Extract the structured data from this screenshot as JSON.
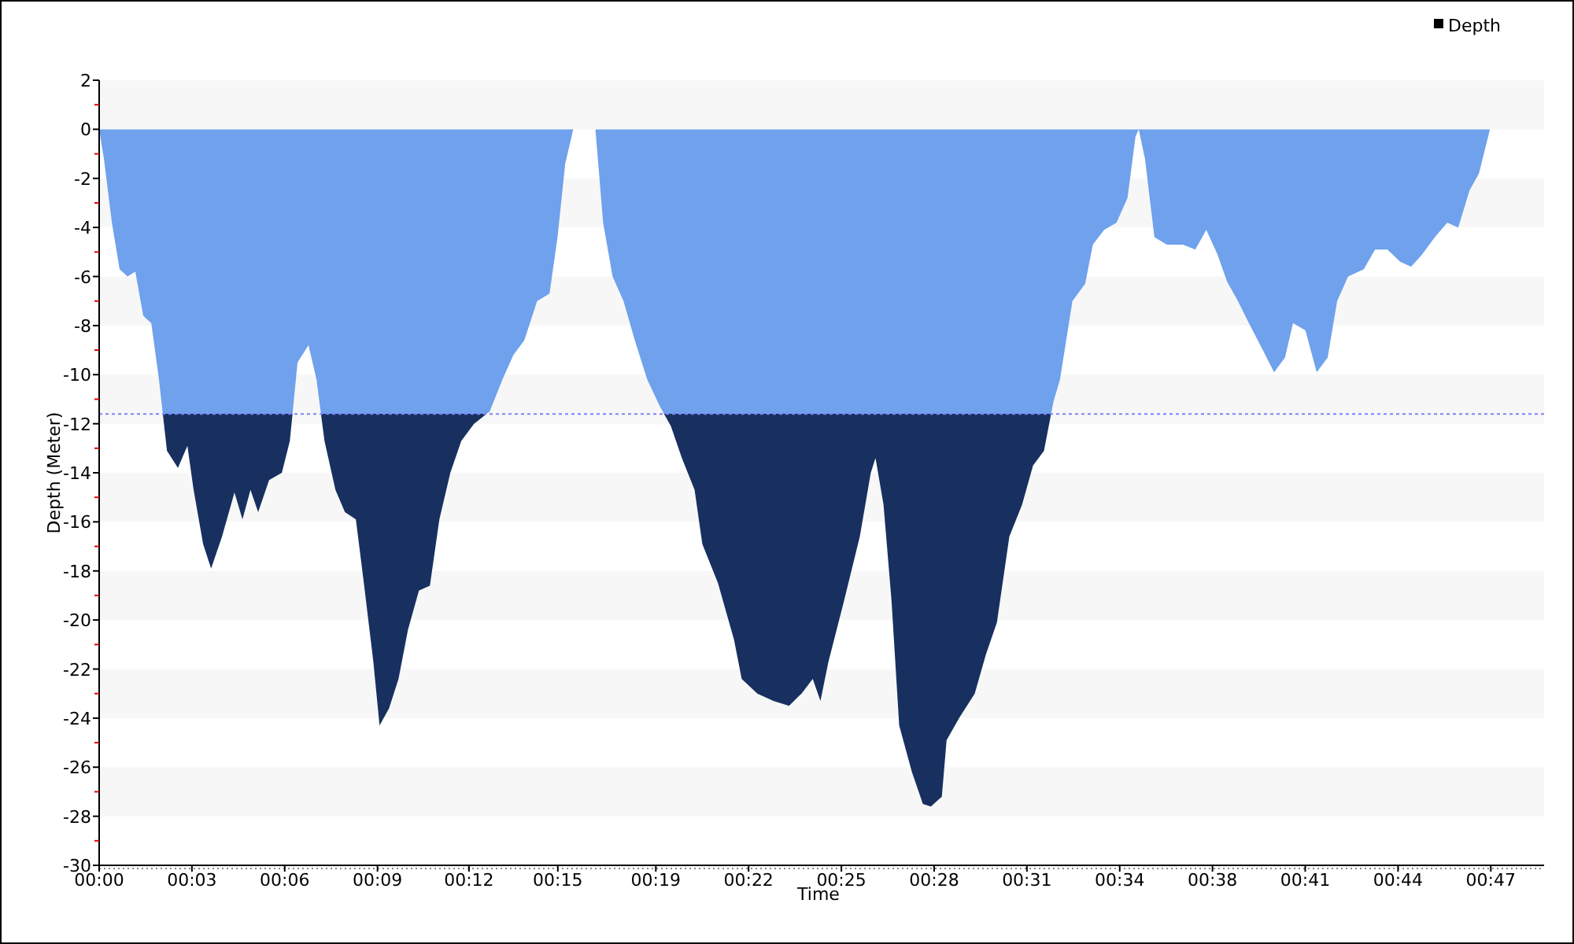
{
  "chart": {
    "chart_data": {
      "type": "area",
      "xlabel": "Time",
      "ylabel": "Depth (Meter)",
      "x": [
        0,
        0.16,
        0.43,
        0.69,
        0.96,
        1.22,
        1.49,
        1.76,
        2.02,
        2.29,
        2.66,
        2.98,
        3.19,
        3.51,
        3.78,
        4.15,
        4.57,
        4.84,
        5.11,
        5.37,
        5.74,
        6.17,
        6.44,
        6.7,
        7.07,
        7.34,
        7.61,
        7.98,
        8.3,
        8.67,
        8.94,
        9.26,
        9.47,
        9.79,
        10.11,
        10.43,
        10.8,
        11.17,
        11.49,
        11.86,
        12.23,
        12.66,
        13.19,
        13.62,
        13.99,
        14.36,
        14.79,
        15.21,
        15.48,
        15.74,
        16.01,
        16.76,
        17.02,
        17.34,
        17.71,
        18.09,
        18.51,
        18.94,
        19.31,
        19.68,
        20.11,
        20.37,
        20.9,
        21.44,
        21.7,
        22.23,
        22.77,
        23.3,
        23.72,
        24.1,
        24.36,
        24.63,
        25.16,
        25.69,
        26.06,
        26.22,
        26.49,
        26.76,
        27.02,
        27.45,
        27.82,
        28.09,
        28.46,
        28.62,
        29.04,
        29.57,
        29.95,
        30.32,
        30.74,
        31.17,
        31.54,
        31.91,
        32.23,
        32.45,
        32.87,
        33.3,
        33.56,
        33.94,
        34.36,
        34.73,
        35.0,
        35.11,
        35.32,
        35.64,
        36.06,
        36.6,
        37.02,
        37.39,
        37.77,
        38.09,
        38.46,
        38.83,
        39.26,
        39.68,
        40.05,
        40.32,
        40.74,
        41.12,
        41.49,
        41.81,
        42.18,
        42.71,
        43.09,
        43.51,
        43.94,
        44.31,
        44.68,
        45.11,
        45.53,
        45.9,
        46.28,
        46.6,
        46.97
      ],
      "series": [
        {
          "name": "Depth",
          "color": "#6fa1ec",
          "values": [
            0,
            -1.2,
            -3.8,
            -5.7,
            -6.0,
            -5.8,
            -7.6,
            -7.9,
            -10.2,
            -13.1,
            -13.8,
            -12.9,
            -14.7,
            -16.9,
            -17.9,
            -16.6,
            -14.8,
            -15.9,
            -14.7,
            -15.6,
            -14.3,
            -14.0,
            -12.7,
            -9.5,
            -8.8,
            -10.2,
            -12.7,
            -14.7,
            -15.6,
            -15.9,
            -18.5,
            -21.7,
            -24.3,
            -23.6,
            -22.4,
            -20.4,
            -18.8,
            -18.6,
            -15.9,
            -14.0,
            -12.7,
            -12.0,
            -11.5,
            -10.2,
            -9.2,
            -8.6,
            -7.0,
            -6.7,
            -4.4,
            -1.4,
            0,
            0,
            -3.8,
            -6.0,
            -7.0,
            -8.6,
            -10.2,
            -11.3,
            -12.1,
            -13.4,
            -14.7,
            -16.9,
            -18.5,
            -20.8,
            -22.4,
            -23.0,
            -23.3,
            -23.5,
            -23.0,
            -22.4,
            -23.3,
            -21.7,
            -19.2,
            -16.6,
            -14.0,
            -13.4,
            -15.3,
            -19.2,
            -24.3,
            -26.2,
            -27.5,
            -27.6,
            -27.2,
            -24.9,
            -24.0,
            -23.0,
            -21.4,
            -20.1,
            -16.6,
            -15.3,
            -13.7,
            -13.1,
            -11.1,
            -10.2,
            -7.0,
            -6.3,
            -4.7,
            -4.1,
            -3.8,
            -2.8,
            -0.3,
            0,
            -1.2,
            -4.4,
            -4.7,
            -4.7,
            -4.9,
            -4.1,
            -5.1,
            -6.2,
            -7.0,
            -7.9,
            -8.9,
            -9.9,
            -9.3,
            -7.9,
            -8.2,
            -9.9,
            -9.3,
            -7.0,
            -6.0,
            -5.7,
            -4.9,
            -4.9,
            -5.4,
            -5.6,
            -5.1,
            -4.4,
            -3.8,
            -4.0,
            -2.5,
            -1.8,
            0
          ]
        }
      ],
      "xlim": [
        0,
        48.8
      ],
      "ylim": [
        -30,
        2
      ],
      "xticks": [
        {
          "value": 0,
          "label": "00:00"
        },
        {
          "value": 3.133,
          "label": "00:03"
        },
        {
          "value": 6.267,
          "label": "00:06"
        },
        {
          "value": 9.4,
          "label": "00:09"
        },
        {
          "value": 12.49,
          "label": "00:12"
        },
        {
          "value": 15.49,
          "label": "00:15"
        },
        {
          "value": 18.8,
          "label": "00:19"
        },
        {
          "value": 21.933,
          "label": "00:22"
        },
        {
          "value": 25.067,
          "label": "00:25"
        },
        {
          "value": 28.2,
          "label": "00:28"
        },
        {
          "value": 31.333,
          "label": "00:31"
        },
        {
          "value": 34.467,
          "label": "00:34"
        },
        {
          "value": 37.6,
          "label": "00:38"
        },
        {
          "value": 40.733,
          "label": "00:41"
        },
        {
          "value": 43.867,
          "label": "00:44"
        },
        {
          "value": 47,
          "label": "00:47"
        }
      ],
      "yticks": [
        2,
        0,
        -2,
        -4,
        -6,
        -8,
        -10,
        -12,
        -14,
        -16,
        -18,
        -20,
        -22,
        -24,
        -26,
        -28,
        -30
      ],
      "ref_lines": [
        {
          "axis": "y",
          "value": -11.6,
          "color": "#8080ff"
        }
      ]
    }
  }
}
